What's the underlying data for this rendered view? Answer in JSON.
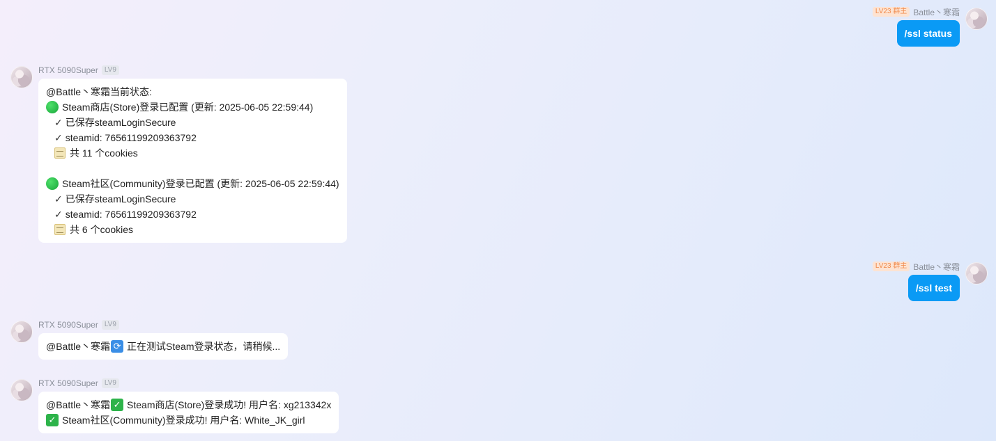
{
  "me": {
    "badge": "LV23 群主",
    "name": "Battle丶寒霜"
  },
  "bot": {
    "name": "RTX 5090Super",
    "level": "LV9"
  },
  "messages": {
    "m1": {
      "text": "/ssl status"
    },
    "m2": {
      "line1": "@Battle丶寒霜当前状态:",
      "store_title": "Steam商店(Store)登录已配置 (更新: 2025-06-05 22:59:44)",
      "store_saved": "已保存steamLoginSecure",
      "store_steamid": "steamid: 76561199209363792",
      "store_cookies": "共 11 个cookies",
      "community_title": "Steam社区(Community)登录已配置 (更新: 2025-06-05 22:59:44)",
      "community_saved": "已保存steamLoginSecure",
      "community_steamid": "steamid: 76561199209363792",
      "community_cookies": "共 6 个cookies"
    },
    "m3": {
      "text": "/ssl test"
    },
    "m4": {
      "mention": "@Battle丶寒霜",
      "text": "正在测试Steam登录状态，请稍候..."
    },
    "m5": {
      "mention": "@Battle丶寒霜",
      "line1": "Steam商店(Store)登录成功! 用户名: xg213342x",
      "line2": "Steam社区(Community)登录成功! 用户名: White_JK_girl"
    }
  },
  "glyphs": {
    "tick": "✓",
    "check": "✓",
    "refresh": "⟳"
  },
  "colors": {
    "my_bubble": "#0a9af5",
    "owner_badge_bg": "#fde3d2",
    "owner_badge_fg": "#f08a4b"
  }
}
